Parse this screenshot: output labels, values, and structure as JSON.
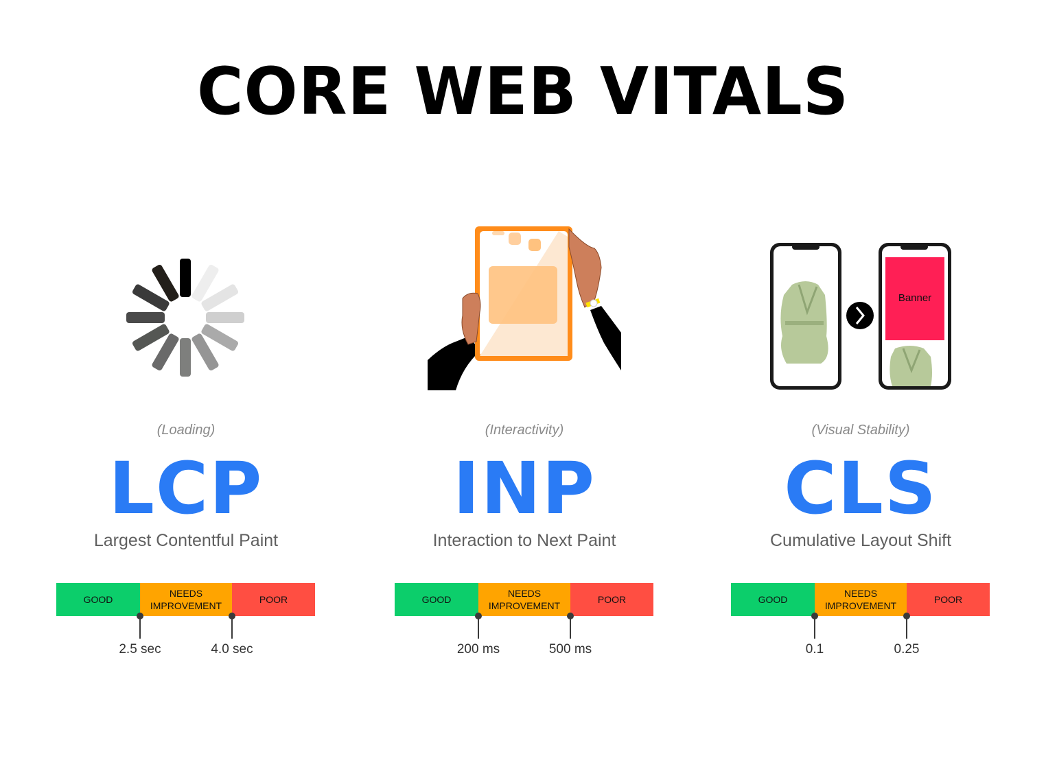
{
  "title": "CORE WEB VITALS",
  "colors": {
    "accent_blue": "#2a7bf5",
    "good": "#0cce6b",
    "needs_improvement": "#ffa400",
    "poor": "#ff4e42",
    "banner": "#ff1f55"
  },
  "metrics": [
    {
      "category": "(Loading)",
      "acronym": "LCP",
      "name": "Largest Contentful Paint",
      "illustration": "loading-spinner-icon",
      "scale": {
        "good": "GOOD",
        "needs_line1": "NEEDS",
        "needs_line2": "IMPROVEMENT",
        "poor": "POOR"
      },
      "thresholds": [
        "2.5 sec",
        "4.0 sec"
      ]
    },
    {
      "category": "(Interactivity)",
      "acronym": "INP",
      "name": "Interaction to Next Paint",
      "illustration": "hands-tapping-tablet-icon",
      "scale": {
        "good": "GOOD",
        "needs_line1": "NEEDS",
        "needs_line2": "IMPROVEMENT",
        "poor": "POOR"
      },
      "thresholds": [
        "200 ms",
        "500 ms"
      ]
    },
    {
      "category": "(Visual Stability)",
      "acronym": "CLS",
      "name": "Cumulative Layout Shift",
      "illustration": "phone-layout-shift-icon",
      "banner_label": "Banner",
      "scale": {
        "good": "GOOD",
        "needs_line1": "NEEDS",
        "needs_line2": "IMPROVEMENT",
        "poor": "POOR"
      },
      "thresholds": [
        "0.1",
        "0.25"
      ]
    }
  ]
}
